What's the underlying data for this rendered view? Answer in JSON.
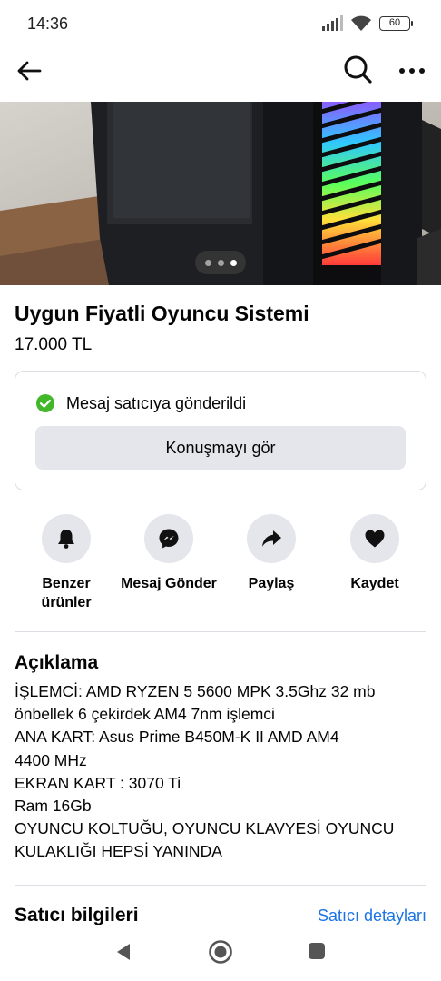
{
  "status_bar": {
    "time": "14:36",
    "battery": "60",
    "icons": [
      "signal-icon",
      "wifi-icon",
      "battery-icon"
    ]
  },
  "top_nav": {
    "icons": [
      "back-arrow-icon",
      "search-icon",
      "more-icon"
    ]
  },
  "gallery": {
    "page_count": 3,
    "active_page": 3
  },
  "listing": {
    "title": "Uygun Fiyatli Oyuncu Sistemi",
    "price": "17.000 TL"
  },
  "message_card": {
    "status": "Mesaj satıcıya gönderildi",
    "button": "Konuşmayı gör"
  },
  "actions": [
    {
      "label": "Benzer\nürünler",
      "icon": "bell-icon"
    },
    {
      "label": "Mesaj Gönder",
      "icon": "messenger-icon"
    },
    {
      "label": "Paylaş",
      "icon": "share-icon"
    },
    {
      "label": "Kaydet",
      "icon": "heart-icon"
    }
  ],
  "description": {
    "heading": "Açıklama",
    "lines": [
      "İŞLEMCİ: AMD RYZEN 5 5600 MPK 3.5Ghz 32 mb",
      "önbellek 6 çekirdek AM4 7nm işlemci",
      "ANA KART: Asus Prime B450M-K II AMD AM4",
      "4400 MHz",
      "EKRAN KART : 3070 Ti",
      "Ram 16Gb",
      "OYUNCU KOLTUĞU, OYUNCU KLAVYESİ OYUNCU",
      "KULAKLIĞI HEPSİ YANINDA"
    ]
  },
  "seller": {
    "heading": "Satıcı bilgileri",
    "link": "Satıcı detayları"
  },
  "colors": {
    "accent": "#1b74e4",
    "success": "#42b72a",
    "button_bg": "#e4e6eb",
    "divider": "#dadde1"
  }
}
